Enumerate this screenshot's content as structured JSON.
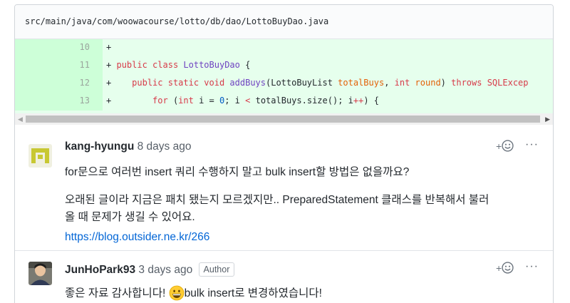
{
  "file": {
    "path": "src/main/java/com/woowacourse/lotto/db/dao/LottoBuyDao.java"
  },
  "diff": {
    "lines": [
      {
        "num": "10",
        "marker": "+"
      },
      {
        "num": "11",
        "marker": "+",
        "t1": "public class ",
        "t2": "LottoBuyDao",
        "t3": " {"
      },
      {
        "num": "12",
        "marker": "+",
        "t1": "public static void ",
        "t2": "addBuys",
        "t3": "(LottoBuyList ",
        "t4": "totalBuys",
        "t5": ", ",
        "t6": "int ",
        "t7": "round",
        "t8": ") ",
        "t9": "throws SQLExcep"
      },
      {
        "num": "13",
        "marker": "+",
        "t1": "for",
        "t2": " (",
        "t3": "int ",
        "t4": "i",
        "t5": " = ",
        "t6": "0",
        "t7": "; i ",
        "t8": "<",
        "t9": " totalBuys.size(); i",
        "t10": "++",
        "t11": ") {"
      }
    ]
  },
  "scrollbar": {
    "left_arrow": "◀",
    "right_arrow": "▶"
  },
  "comments": [
    {
      "author": "kang-hyungu",
      "time": "8 days ago",
      "reaction_plus": "+",
      "more": "···",
      "para1": "for문으로 여러번 insert 쿼리 수행하지 말고 bulk insert할 방법은 없을까요?",
      "para2_line1": "오래된 글이라 지금은 패치 됐는지 모르겠지만.. PreparedStatement 클래스를 반복해서 불러",
      "para2_line2": "올 때 문제가 생길 수 있어요.",
      "link": "https://blog.outsider.ne.kr/266"
    },
    {
      "author": "JunHoPark93",
      "time": "3 days ago",
      "badge": "Author",
      "reaction_plus": "+",
      "more": "···",
      "text_before": "좋은 자료 감사합니다!",
      "text_after": "bulk insert로 변경하였습니다!"
    }
  ],
  "colors": {
    "added_line_bg": "#e6ffed",
    "added_gutter_bg": "#cdffd8",
    "link": "#0366d6",
    "keyword": "#d73a49",
    "entity": "#6f42c1"
  }
}
